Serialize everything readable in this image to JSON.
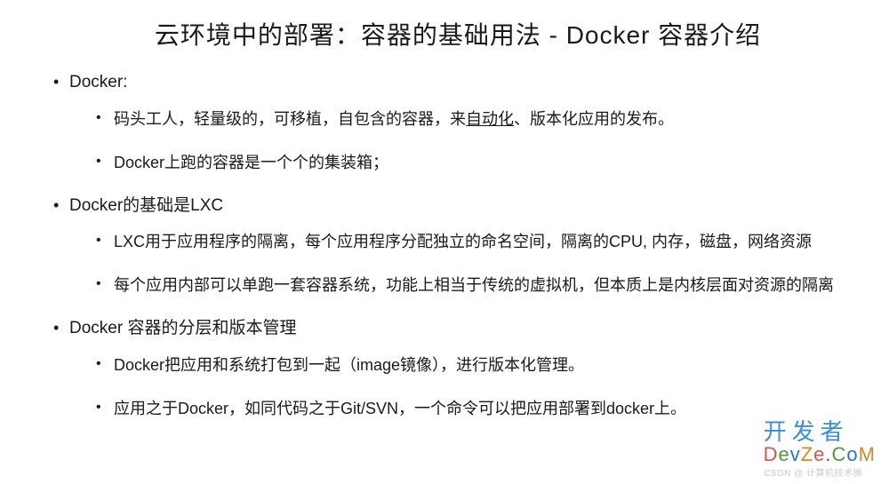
{
  "title": "云环境中的部署：容器的基础用法 - Docker 容器介绍",
  "sections": [
    {
      "heading": "Docker:",
      "items": [
        {
          "pre": "码头工人，轻量级的，可移植，自包含的容器，来",
          "u": "自动化",
          "post": "、版本化应用的发布。"
        },
        {
          "pre": "Docker上跑的容器是一个个的集装箱；",
          "u": "",
          "post": ""
        }
      ]
    },
    {
      "heading": "Docker的基础是LXC",
      "items": [
        {
          "pre": "LXC用于应用程序的隔离，每个应用程序分配独立的命名空间，隔离的CPU, 内存，磁盘，网络资源",
          "u": "",
          "post": ""
        },
        {
          "pre": "每个应用内部可以单跑一套容器系统，功能上相当于传统的虚拟机，但本质上是内核层面对资源的隔离",
          "u": "",
          "post": ""
        }
      ]
    },
    {
      "heading": "Docker 容器的分层和版本管理",
      "items": [
        {
          "pre": "Docker把应用和系统打包到一起（image镜像），进行版本化管理。",
          "u": "",
          "post": ""
        },
        {
          "pre": "应用之于Docker，如同代码之于Git/SVN，一个命令可以把应用部署到docker上。",
          "u": "",
          "post": ""
        }
      ]
    }
  ],
  "watermark": {
    "top": "开发者",
    "bottom": [
      "D",
      "e",
      "v",
      "Z",
      "e",
      ".",
      "C",
      "o",
      "M"
    ]
  },
  "attribution": "CSDN @ 计算机技术狮"
}
